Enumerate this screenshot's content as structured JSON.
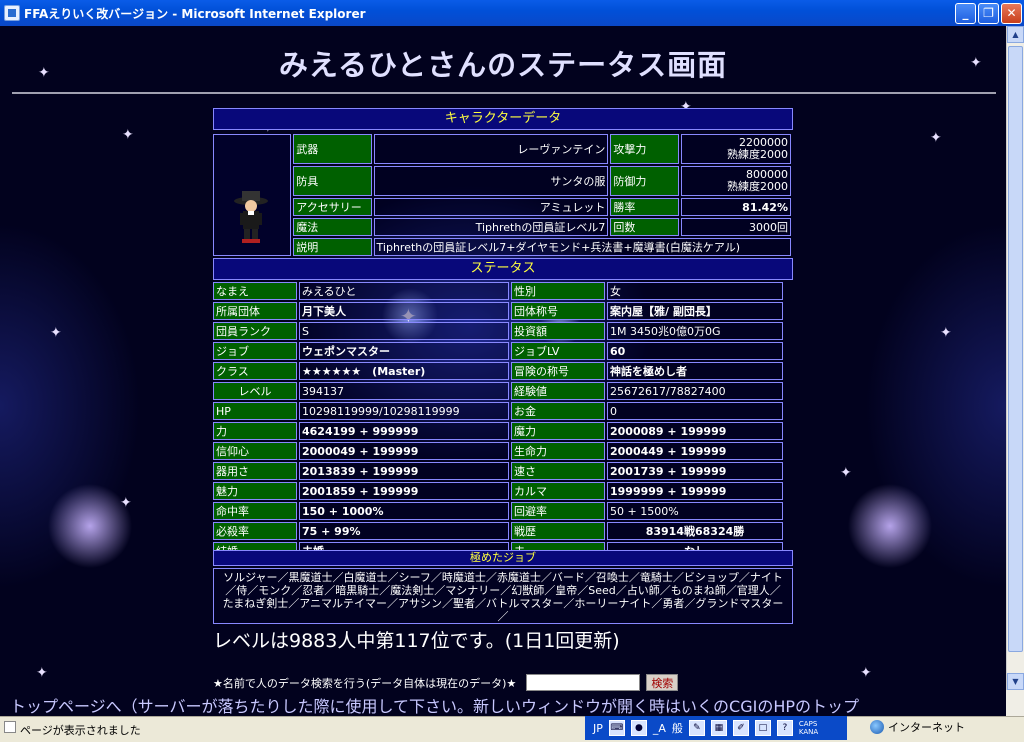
{
  "window": {
    "title": "FFAえりいく改バージョン - Microsoft Internet Explorer",
    "minimize": "_",
    "maximize": "❐",
    "close": "✕"
  },
  "page": {
    "title": "みえるひとさんのステータス画面"
  },
  "character": {
    "header": "キャラクターデータ",
    "avatar_icon": "character-sprite-icon",
    "rows": {
      "weapon_label": "武器",
      "weapon_value": "レーヴァンテイン",
      "attack_label": "攻撃力",
      "attack_value": "2200000",
      "attack_mastery": "熟練度2000",
      "armor_label": "防具",
      "armor_value": "サンタの服",
      "defense_label": "防御力",
      "defense_value": "800000",
      "defense_mastery": "熟練度2000",
      "accessory_label": "アクセサリー",
      "accessory_value": "アミュレット",
      "winrate_label": "勝率",
      "winrate_value": "81.42%",
      "magic_label": "魔法",
      "magic_value": "Tiphrethの団員証レベル7",
      "count_label": "回数",
      "count_value": "3000回",
      "desc_label": "説明",
      "desc_value": "Tiphrethの団員証レベル7+ダイヤモンド+兵法書+魔導書(白魔法ケアル)"
    }
  },
  "status": {
    "header": "ステータス",
    "rows": [
      {
        "l1": "なまえ",
        "v1": "みえるひと",
        "l2": "性別",
        "v2": "女"
      },
      {
        "l1": "所属団体",
        "v1": "月下美人",
        "l2": "団体称号",
        "v2": "案内屋【雅/ 副団長】"
      },
      {
        "l1": "団員ランク",
        "v1": "S",
        "l2": "投資額",
        "v2": "1M 3450兆0億0万0G"
      },
      {
        "l1": "ジョブ",
        "v1": "ウェポンマスター",
        "l2": "ジョブLV",
        "v2": "60"
      },
      {
        "l1": "クラス",
        "v1": "★★★★★★　(Master)",
        "l2": "冒険の称号",
        "v2": "神話を極めし者"
      },
      {
        "l1": "レベル",
        "v1": "394137",
        "l2": "経験値",
        "v2": "25672617/78827400"
      },
      {
        "l1": "HP",
        "v1": "10298119999/10298119999",
        "l2": "お金",
        "v2": "0"
      },
      {
        "l1": "力",
        "v1": "4624199 + 999999",
        "l2": "魔力",
        "v2": "2000089 + 199999"
      },
      {
        "l1": "信仰心",
        "v1": "2000049 + 199999",
        "l2": "生命力",
        "v2": "2000449 + 199999"
      },
      {
        "l1": "器用さ",
        "v1": "2013839 + 199999",
        "l2": "速さ",
        "v2": "2001739 + 199999"
      },
      {
        "l1": "魅力",
        "v1": "2001859 + 199999",
        "l2": "カルマ",
        "v2": "1999999 + 199999"
      },
      {
        "l1": "命中率",
        "v1": "150 + 1000%",
        "l2": "回避率",
        "v2": "50 + 1500%"
      },
      {
        "l1": "必殺率",
        "v1": "75 + 99%",
        "l2": "戦歴",
        "v2": "83914戦68324勝"
      },
      {
        "l1": "結婚",
        "v1": "未婚",
        "l2": "夫",
        "v2": "なし"
      }
    ]
  },
  "jobs": {
    "header": "極めたジョブ",
    "list": "ソルジャー／黒魔道士／白魔道士／シーフ／時魔道士／赤魔道士／バード／召喚士／竜騎士／ビショップ／ナイト／侍／モンク／忍者／暗黒騎士／魔法剣士／マシナリー／幻獣師／皇帝／Seed／占い師／ものまね師／官理人／たまねぎ剣士／アニマルテイマー／アサシン／聖者／バトルマスター／ホーリーナイト／勇者／グランドマスター／"
  },
  "ranking": {
    "text": "レベルは9883人中第117位です。(1日1回更新)"
  },
  "search": {
    "label": "★名前で人のデータ検索を行う(データ自体は現在のデータ)★",
    "input_value": "",
    "button": "検索"
  },
  "footer": {
    "toplink": "トップページへ（サーバーが落ちたりした際に使用して下さい。新しいウィンドウが開く時はいくのCGIのHPのトップ"
  },
  "statusbar": {
    "text": "ページが表示されました",
    "lang": "JP",
    "ime": "般",
    "ime_mode": "_A",
    "caps": "CAPS",
    "kana": "KANA",
    "zone": "インターネット"
  }
}
